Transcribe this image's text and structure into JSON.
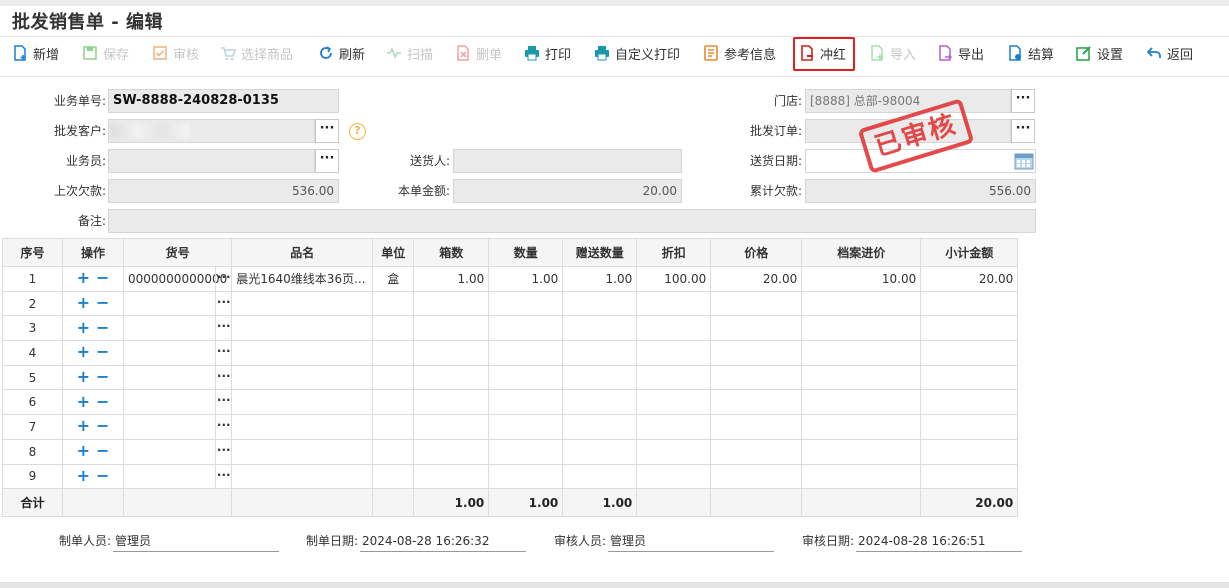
{
  "page_title": "批发销售单 - 编辑",
  "toolbar": [
    {
      "key": "add",
      "label": "新增",
      "enabled": true,
      "icon": "new-doc-icon",
      "color": "#1a7fd1"
    },
    {
      "key": "save",
      "label": "保存",
      "enabled": false,
      "icon": "save-icon",
      "color": "#8cd38c"
    },
    {
      "key": "audit",
      "label": "审核",
      "enabled": false,
      "icon": "audit-check-icon",
      "color": "#f0b080"
    },
    {
      "key": "select",
      "label": "选择商品",
      "enabled": false,
      "icon": "cart-icon",
      "color": "#c0d0e0"
    },
    {
      "key": "refresh",
      "label": "刷新",
      "enabled": true,
      "icon": "refresh-icon",
      "color": "#1a7fd1"
    },
    {
      "key": "scan",
      "label": "扫描",
      "enabled": false,
      "icon": "scan-icon",
      "color": "#b0d8c0"
    },
    {
      "key": "delete",
      "label": "删单",
      "enabled": false,
      "icon": "delete-doc-icon",
      "color": "#f3a0a0"
    },
    {
      "key": "print",
      "label": "打印",
      "enabled": true,
      "icon": "printer-icon",
      "color": "#1a9aa8"
    },
    {
      "key": "custom_print",
      "label": "自定义打印",
      "enabled": true,
      "icon": "custom-printer-icon",
      "color": "#1a9aa8"
    },
    {
      "key": "reference",
      "label": "参考信息",
      "enabled": true,
      "icon": "info-list-icon",
      "color": "#e58a2c"
    },
    {
      "key": "reverse",
      "label": "冲红",
      "enabled": true,
      "icon": "reverse-doc-icon",
      "color": "#d62020"
    },
    {
      "key": "import",
      "label": "导入",
      "enabled": false,
      "icon": "import-icon",
      "color": "#a0e0b0"
    },
    {
      "key": "export",
      "label": "导出",
      "enabled": true,
      "icon": "export-icon",
      "color": "#b060d0"
    },
    {
      "key": "settle",
      "label": "结算",
      "enabled": true,
      "icon": "settle-icon",
      "color": "#1a7fd1"
    },
    {
      "key": "settings",
      "label": "设置",
      "enabled": true,
      "icon": "settings-edit-icon",
      "color": "#2fa84a"
    },
    {
      "key": "back",
      "label": "返回",
      "enabled": true,
      "icon": "back-arrow-icon",
      "color": "#1a7fd1"
    }
  ],
  "form": {
    "order_no_label": "业务单号:",
    "order_no": "SW-8888-240828-0135",
    "store_label": "门店:",
    "store": "[8888] 总部-98004",
    "customer_label": "批发客户:",
    "customer": "",
    "wholesale_order_label": "批发订单:",
    "wholesale_order": "",
    "salesman_label": "业务员:",
    "salesman": "",
    "deliverer_label": "送货人:",
    "deliverer": "",
    "delivery_date_label": "送货日期:",
    "delivery_date": "",
    "prev_debt_label": "上次欠款:",
    "prev_debt": "536.00",
    "amount_label": "本单金额:",
    "amount": "20.00",
    "total_debt_label": "累计欠款:",
    "total_debt": "556.00",
    "remark_label": "备注:",
    "remark": ""
  },
  "stamp_text": "已审核",
  "grid": {
    "headers": [
      "序号",
      "操作",
      "货号",
      "品名",
      "单位",
      "箱数",
      "数量",
      "赠送数量",
      "折扣",
      "价格",
      "档案进价",
      "小计金额"
    ],
    "rows": [
      {
        "no": "1",
        "code": "0000000000000",
        "name": "晨光1640维线本36页...",
        "unit": "盒",
        "boxes": "1.00",
        "qty": "1.00",
        "gift": "1.00",
        "discount": "100.00",
        "price": "20.00",
        "cost": "10.00",
        "subtotal": "20.00"
      },
      {
        "no": "2"
      },
      {
        "no": "3"
      },
      {
        "no": "4"
      },
      {
        "no": "5"
      },
      {
        "no": "6"
      },
      {
        "no": "7"
      },
      {
        "no": "8"
      },
      {
        "no": "9"
      }
    ],
    "sum": {
      "label": "合计",
      "boxes": "1.00",
      "qty": "1.00",
      "gift": "1.00",
      "subtotal": "20.00"
    }
  },
  "footer": {
    "creator_label": "制单人员:",
    "creator": "管理员",
    "create_date_label": "制单日期:",
    "create_date": "2024-08-28 16:26:32",
    "auditor_label": "审核人员:",
    "auditor": "管理员",
    "audit_date_label": "审核日期:",
    "audit_date": "2024-08-28 16:26:51"
  }
}
